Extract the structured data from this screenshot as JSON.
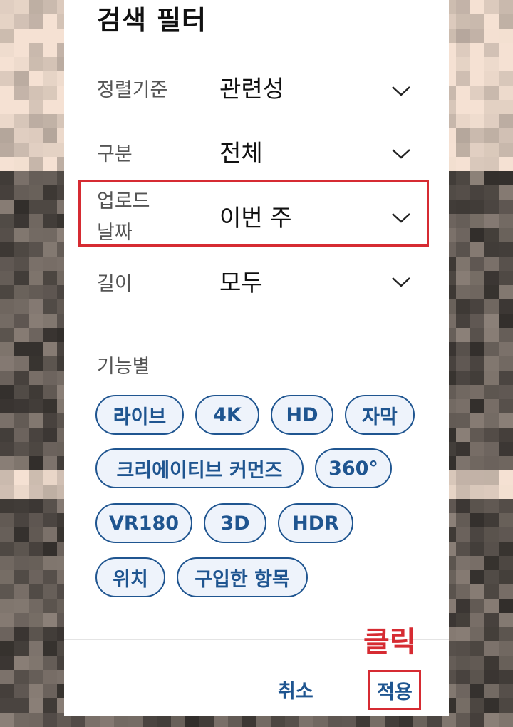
{
  "dialog": {
    "title": "검색 필터",
    "rows": [
      {
        "label": "정렬기준",
        "value": "관련성"
      },
      {
        "label": "구분",
        "value": "전체"
      },
      {
        "label_line1": "업로드",
        "label_line2": "날짜",
        "value": "이번 주"
      },
      {
        "label": "길이",
        "value": "모두"
      }
    ],
    "features": {
      "label": "기능별",
      "chips": [
        "라이브",
        "4K",
        "HD",
        "자막",
        "크리에이티브 커먼즈",
        "360°",
        "VR180",
        "3D",
        "HDR",
        "위치",
        "구입한 항목"
      ]
    },
    "actions": {
      "cancel": "취소",
      "apply": "적용"
    }
  },
  "annotation": {
    "click_label": "클릭",
    "highlight_color": "#d62b32"
  },
  "colors": {
    "accent": "#1f5590",
    "chip_bg": "#eef3fb"
  },
  "icons": {
    "dropdown": "chevron-down-icon"
  }
}
